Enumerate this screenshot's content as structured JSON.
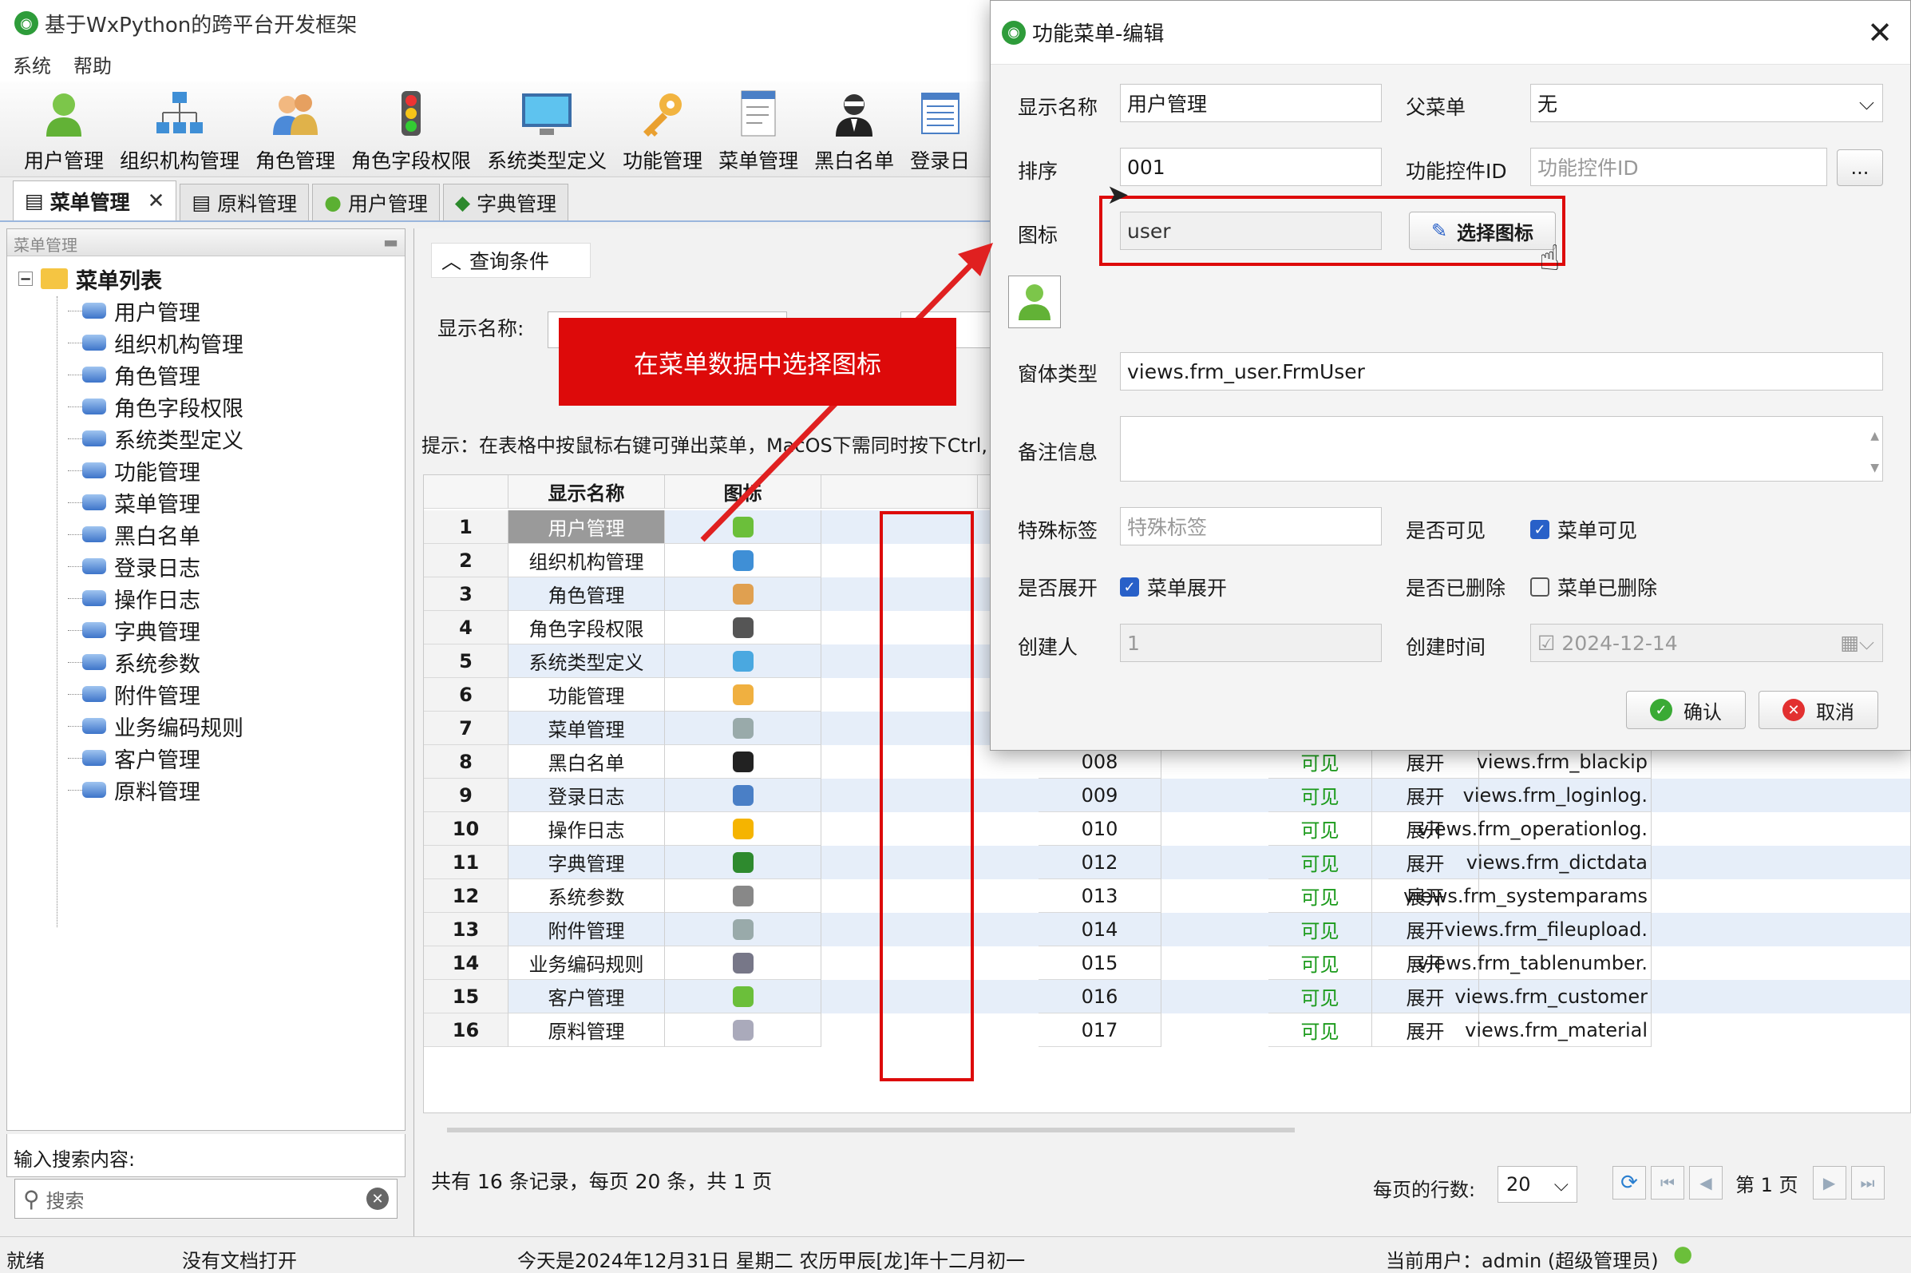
{
  "app": {
    "title": "基于WxPython的跨平台开发框架",
    "menu": [
      "系统",
      "帮助"
    ]
  },
  "toolbar": [
    "用户管理",
    "组织机构管理",
    "角色管理",
    "角色字段权限",
    "系统类型定义",
    "功能管理",
    "菜单管理",
    "黑白名单",
    "登录日"
  ],
  "tabs": [
    "菜单管理",
    "原料管理",
    "用户管理",
    "字典管理"
  ],
  "left": {
    "header": "菜单管理",
    "root": "菜单列表",
    "items": [
      "用户管理",
      "组织机构管理",
      "角色管理",
      "角色字段权限",
      "系统类型定义",
      "功能管理",
      "菜单管理",
      "黑白名单",
      "登录日志",
      "操作日志",
      "字典管理",
      "系统参数",
      "附件管理",
      "业务编码规则",
      "客户管理",
      "原料管理"
    ],
    "search_label": "输入搜索内容:",
    "search_placeholder": "搜索"
  },
  "query": {
    "title": "查询条件",
    "label": "显示名称:",
    "hint": "提示：在表格中按鼠标右键可弹出菜单，MacOS下需同时按下Ctrl,"
  },
  "grid": {
    "headers": [
      "显示名称",
      "图标"
    ],
    "visible_text": "可见",
    "expand_text": "展开",
    "rows": [
      {
        "no": "1",
        "name": "用户管理",
        "icon": "user-icon"
      },
      {
        "no": "2",
        "name": "组织机构管理",
        "icon": "org-icon"
      },
      {
        "no": "3",
        "name": "角色管理",
        "icon": "role-icon"
      },
      {
        "no": "4",
        "name": "角色字段权限",
        "icon": "traffic-light-icon"
      },
      {
        "no": "5",
        "name": "系统类型定义",
        "icon": "monitor-icon"
      },
      {
        "no": "6",
        "name": "功能管理",
        "icon": "key-icon"
      },
      {
        "no": "7",
        "name": "菜单管理",
        "icon": "document-icon"
      },
      {
        "no": "8",
        "name": "黑白名单",
        "code": "008",
        "view": "views.frm_blackip",
        "icon": "spy-icon"
      },
      {
        "no": "9",
        "name": "登录日志",
        "code": "009",
        "view": "views.frm_loginlog.",
        "icon": "list-icon"
      },
      {
        "no": "10",
        "name": "操作日志",
        "code": "010",
        "view": "views.frm_operationlog.",
        "icon": "warning-icon"
      },
      {
        "no": "11",
        "name": "字典管理",
        "code": "012",
        "view": "views.frm_dictdata",
        "icon": "tag-icon"
      },
      {
        "no": "12",
        "name": "系统参数",
        "code": "013",
        "view": "views.frm_systemparams",
        "icon": "tools-icon"
      },
      {
        "no": "13",
        "name": "附件管理",
        "code": "014",
        "view": "views.frm_fileupload.",
        "icon": "paperclip-icon"
      },
      {
        "no": "14",
        "name": "业务编码规则",
        "code": "015",
        "view": "views.frm_tablenumber.",
        "icon": "calculator-icon"
      },
      {
        "no": "15",
        "name": "客户管理",
        "code": "016",
        "view": "views.frm_customer",
        "icon": "customer-icon"
      },
      {
        "no": "16",
        "name": "原料管理",
        "code": "017",
        "view": "views.frm_material",
        "icon": "material-icon"
      }
    ]
  },
  "pager": {
    "summary": "共有 16 条记录，每页 20 条，共 1 页",
    "rows_label": "每页的行数:",
    "page_size": "20",
    "page_text": "第 1 页"
  },
  "status": {
    "ready": "就绪",
    "doc": "没有文档打开",
    "date": "今天是2024年12月31日 星期二 农历甲辰[龙]年十二月初一",
    "user": "当前用户：admin (超级管理员)"
  },
  "dialog": {
    "title": "功能菜单-编辑",
    "labels": {
      "name": "显示名称",
      "parent": "父菜单",
      "sort": "排序",
      "control_id": "功能控件ID",
      "icon": "图标",
      "form_type": "窗体类型",
      "remark": "备注信息",
      "special": "特殊标签",
      "visible": "是否可见",
      "expand": "是否展开",
      "deleted": "是否已删除",
      "creator": "创建人",
      "created": "创建时间"
    },
    "values": {
      "name": "用户管理",
      "parent": "无",
      "sort": "001",
      "control_id_placeholder": "功能控件ID",
      "icon": "user",
      "form_type": "views.frm_user.FrmUser",
      "special_placeholder": "特殊标签",
      "visible_label": "菜单可见",
      "expand_label": "菜单展开",
      "deleted_label": "菜单已删除",
      "creator": "1",
      "created": "2024-12-14"
    },
    "checked": {
      "visible": true,
      "expand": true,
      "deleted": false
    },
    "buttons": {
      "pick_icon": "选择图标",
      "ellipsis": "...",
      "ok": "确认",
      "cancel": "取消"
    }
  },
  "annotation": {
    "callout": "在菜单数据中选择图标"
  },
  "colors": {
    "highlight_red": "#dd0a0a",
    "checkbox_blue": "#2860c8",
    "visible_green": "#1a9a1a"
  }
}
